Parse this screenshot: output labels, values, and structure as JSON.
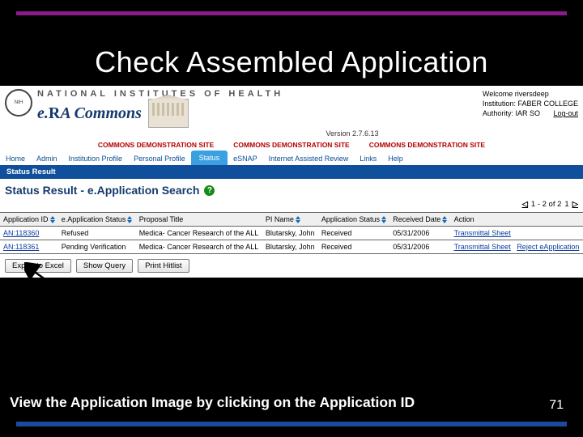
{
  "slide": {
    "title": "Check Assembled Application",
    "caption": "View the Application Image by clicking on the Application ID",
    "page_number": "71"
  },
  "header": {
    "org_name": "NATIONAL INSTITUTES OF HEALTH",
    "app_name_prefix": "e.",
    "app_name_mid": "R",
    "app_name_suffix": "A Commons",
    "version": "Version 2.7.6.13",
    "welcome_label": "Welcome",
    "welcome_user": "riversdeep",
    "institution_label": "Institution:",
    "institution": "FABER COLLEGE",
    "authority_label": "Authority:",
    "authority": "IAR  SO",
    "logout": "Log-out",
    "demo_banner": "COMMONS DEMONSTRATION SITE"
  },
  "nav": {
    "tabs": [
      "Home",
      "Admin",
      "Institution Profile",
      "Personal Profile",
      "Status",
      "eSNAP",
      "Internet Assisted Review",
      "Links",
      "Help"
    ],
    "active_index": 4,
    "sub_label": "Status Result"
  },
  "section": {
    "title": "Status Result - e.Application Search"
  },
  "pager": {
    "range": "1 - 2 of 2",
    "page": "1"
  },
  "table": {
    "columns": [
      "Application ID",
      "e.Application Status",
      "Proposal Title",
      "PI Name",
      "Application Status",
      "Received Date",
      "Action"
    ],
    "rows": [
      {
        "app_id": "AN:118360",
        "eapp_status": "Refused",
        "title": "Medica- Cancer Research of the ALL",
        "pi": "Blutarsky, John",
        "status": "Received",
        "date": "05/31/2006",
        "actions": [
          "Transmittal Sheet"
        ]
      },
      {
        "app_id": "AN:118361",
        "eapp_status": "Pending Verification",
        "title": "Medica- Cancer Research of the ALL",
        "pi": "Blutarsky, John",
        "status": "Received",
        "date": "05/31/2006",
        "actions": [
          "Transmittal Sheet",
          "Reject eApplication"
        ]
      }
    ]
  },
  "buttons": {
    "export": "Export to Excel",
    "show_query": "Show Query",
    "print": "Print Hitlist"
  }
}
